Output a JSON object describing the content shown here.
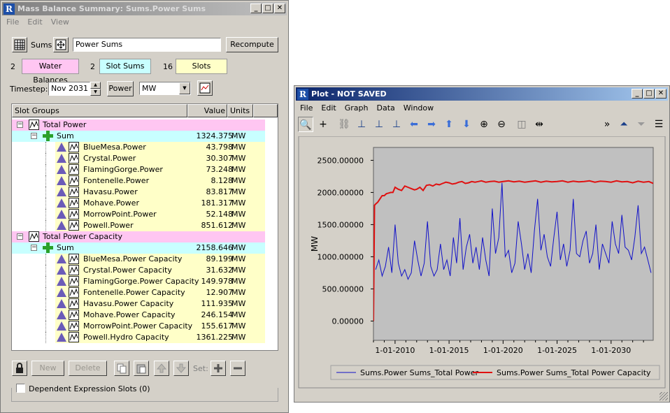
{
  "left_window": {
    "title": "Mass Balance Summary: Sums.Power Sums",
    "menu": [
      "File",
      "Edit",
      "View"
    ],
    "sums_label": "Sums",
    "name_value": "Power Sums",
    "recompute": "Recompute",
    "counts": [
      {
        "count": "2",
        "label": "Water Balances",
        "color": "#ffc6f2"
      },
      {
        "count": "2",
        "label": "Slot Sums",
        "color": "#c8ffff"
      },
      {
        "count": "16",
        "label": "Slots",
        "color": "#ffffc8"
      }
    ],
    "timestep_label": "Timestep:",
    "timestep_value": "Nov 2031",
    "power_label": "Power",
    "unit_value": "MW",
    "tree_headers": {
      "groups": "Slot Groups",
      "value": "Value",
      "units": "Units"
    },
    "groups": [
      {
        "name": "Total Power",
        "sum": {
          "name": "Sum",
          "value": "1324.375",
          "unit": "MW"
        },
        "items": [
          {
            "name": "BlueMesa.Power",
            "value": "43.798",
            "unit": "MW"
          },
          {
            "name": "Crystal.Power",
            "value": "30.307",
            "unit": "MW"
          },
          {
            "name": "FlamingGorge.Power",
            "value": "73.248",
            "unit": "MW"
          },
          {
            "name": "Fontenelle.Power",
            "value": "8.128",
            "unit": "MW"
          },
          {
            "name": "Havasu.Power",
            "value": "83.817",
            "unit": "MW"
          },
          {
            "name": "Mohave.Power",
            "value": "181.317",
            "unit": "MW"
          },
          {
            "name": "MorrowPoint.Power",
            "value": "52.148",
            "unit": "MW"
          },
          {
            "name": "Powell.Power",
            "value": "851.612",
            "unit": "MW"
          }
        ]
      },
      {
        "name": "Total Power Capacity",
        "sum": {
          "name": "Sum",
          "value": "2158.646",
          "unit": "MW"
        },
        "items": [
          {
            "name": "BlueMesa.Power Capacity",
            "value": "89.199",
            "unit": "MW"
          },
          {
            "name": "Crystal.Power Capacity",
            "value": "31.632",
            "unit": "MW"
          },
          {
            "name": "FlamingGorge.Power Capacity",
            "value": "149.978",
            "unit": "MW"
          },
          {
            "name": "Fontenelle.Power Capacity",
            "value": "12.907",
            "unit": "MW"
          },
          {
            "name": "Havasu.Power Capacity",
            "value": "111.935",
            "unit": "MW"
          },
          {
            "name": "Mohave.Power Capacity",
            "value": "246.154",
            "unit": "MW"
          },
          {
            "name": "MorrowPoint.Power Capacity",
            "value": "155.617",
            "unit": "MW"
          },
          {
            "name": "Powell.Hydro Capacity",
            "value": "1361.225",
            "unit": "MW"
          }
        ]
      }
    ],
    "new_label": "New",
    "delete_label": "Delete",
    "set_label": "Set:",
    "dependent_label": "Dependent Expression Slots (0)"
  },
  "plot_window": {
    "title": "Plot - NOT SAVED",
    "menu": [
      "File",
      "Edit",
      "Graph",
      "Data",
      "Window"
    ]
  },
  "chart_data": {
    "type": "line",
    "ylabel": "MW",
    "y_ticks": [
      "0.00000",
      "500.00000",
      "1000.00000",
      "1500.00000",
      "2000.00000",
      "2500.00000"
    ],
    "x_ticks": [
      "1-01-2010",
      "1-01-2015",
      "1-01-2020",
      "1-01-2025",
      "1-01-2030"
    ],
    "ylim": [
      -300,
      2700
    ],
    "xlim": [
      2008.0,
      2033.9
    ],
    "grid": false,
    "legend_position": "bottom",
    "series": [
      {
        "name": "Sums.Power Sums_Total Power",
        "color": "#1010c8",
        "x": [
          2008.2,
          2008.5,
          2008.8,
          2009.1,
          2009.4,
          2009.7,
          2010.0,
          2010.3,
          2010.6,
          2010.9,
          2011.2,
          2011.5,
          2011.8,
          2012.1,
          2012.4,
          2012.7,
          2013.0,
          2013.3,
          2013.6,
          2013.9,
          2014.2,
          2014.5,
          2014.8,
          2015.1,
          2015.4,
          2015.7,
          2016.0,
          2016.3,
          2016.6,
          2016.9,
          2017.2,
          2017.5,
          2017.8,
          2018.1,
          2018.4,
          2018.7,
          2019.0,
          2019.3,
          2019.6,
          2019.9,
          2020.2,
          2020.5,
          2020.8,
          2021.1,
          2021.4,
          2021.7,
          2022.0,
          2022.3,
          2022.6,
          2022.9,
          2023.2,
          2023.5,
          2023.8,
          2024.1,
          2024.4,
          2024.7,
          2025.0,
          2025.3,
          2025.6,
          2025.9,
          2026.2,
          2026.5,
          2026.8,
          2027.1,
          2027.4,
          2027.7,
          2028.0,
          2028.3,
          2028.6,
          2028.9,
          2029.2,
          2029.5,
          2029.8,
          2030.1,
          2030.4,
          2030.7,
          2031.0,
          2031.3,
          2031.6,
          2031.9,
          2032.2,
          2032.5,
          2032.8,
          2033.1,
          2033.4,
          2033.7
        ],
        "values": [
          800,
          950,
          700,
          850,
          1150,
          750,
          1500,
          900,
          700,
          800,
          650,
          750,
          1250,
          950,
          700,
          900,
          1550,
          850,
          700,
          800,
          1200,
          800,
          950,
          700,
          1300,
          900,
          1600,
          800,
          1150,
          1350,
          900,
          1150,
          800,
          1300,
          950,
          700,
          1750,
          1050,
          1300,
          2150,
          1000,
          1100,
          750,
          900,
          1550,
          1200,
          800,
          1050,
          750,
          1400,
          1900,
          1100,
          1350,
          1000,
          850,
          1300,
          1700,
          950,
          1200,
          850,
          1100,
          1900,
          1050,
          1000,
          1250,
          1400,
          900,
          1050,
          1500,
          800,
          1200,
          1050,
          900,
          1550,
          1200,
          1050,
          1650,
          1150,
          1100,
          950,
          1300,
          1800,
          1050,
          1150,
          950,
          750
        ],
        "width": 1
      },
      {
        "name": "Sums.Power Sums_Total Power Capacity",
        "color": "#e01010",
        "x": [
          2008.0,
          2008.1,
          2008.2,
          2008.4,
          2008.6,
          2008.8,
          2009.0,
          2009.2,
          2009.4,
          2009.6,
          2009.8,
          2010.0,
          2010.3,
          2010.6,
          2010.9,
          2011.2,
          2011.5,
          2011.8,
          2012.0,
          2012.3,
          2012.6,
          2012.9,
          2013.2,
          2013.5,
          2013.8,
          2014.1,
          2014.4,
          2014.7,
          2015.0,
          2015.3,
          2015.6,
          2015.9,
          2016.2,
          2016.5,
          2016.8,
          2017.1,
          2017.4,
          2017.7,
          2018.0,
          2018.4,
          2018.8,
          2019.2,
          2019.6,
          2020.0,
          2020.5,
          2021.0,
          2021.5,
          2022.0,
          2022.5,
          2023.0,
          2023.5,
          2024.0,
          2024.5,
          2025.0,
          2025.5,
          2026.0,
          2026.5,
          2027.0,
          2027.5,
          2028.0,
          2028.5,
          2029.0,
          2029.5,
          2030.0,
          2030.5,
          2031.0,
          2031.5,
          2032.0,
          2032.5,
          2033.0,
          2033.5,
          2033.9
        ],
        "values": [
          0,
          1800,
          1820,
          1850,
          1900,
          1950,
          1950,
          1980,
          1990,
          2000,
          2000,
          2080,
          2050,
          2030,
          2100,
          2080,
          2060,
          2040,
          2050,
          2080,
          2030,
          2110,
          2120,
          2100,
          2130,
          2120,
          2140,
          2160,
          2150,
          2130,
          2140,
          2160,
          2170,
          2140,
          2150,
          2170,
          2160,
          2170,
          2180,
          2160,
          2170,
          2175,
          2160,
          2170,
          2180,
          2165,
          2175,
          2160,
          2170,
          2180,
          2160,
          2175,
          2165,
          2170,
          2180,
          2160,
          2175,
          2165,
          2170,
          2180,
          2160,
          2175,
          2170,
          2160,
          2180,
          2165,
          2170,
          2150,
          2175,
          2160,
          2170,
          2140
        ],
        "width": 2
      }
    ]
  }
}
